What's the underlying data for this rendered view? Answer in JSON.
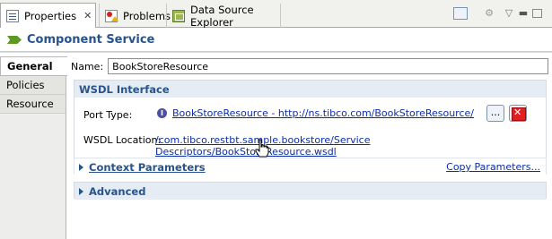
{
  "tabs": [
    {
      "label": "Properties",
      "icon": "properties-icon"
    },
    {
      "label": "Problems",
      "icon": "problems-icon"
    },
    {
      "label": "Data Source Explorer",
      "icon": "data-source-explorer-icon"
    }
  ],
  "header": {
    "title": "Component Service"
  },
  "nav": {
    "items": [
      "General",
      "Policies",
      "Resource"
    ]
  },
  "name_field": {
    "label": "Name:",
    "value": "BookStoreResource"
  },
  "wsdl": {
    "title": "WSDL Interface",
    "port_type_label": "Port Type:",
    "port_type_value": "BookStoreResource - http://ns.tibco.com/BookStoreResource/",
    "browse_label": "...",
    "location_label": "WSDL Location:",
    "location_value": "/com.tibco.restbt.sample.bookstore/Service Descriptors/BookStoreResource.wsdl"
  },
  "context": {
    "title": "Context Parameters",
    "copy_label": "Copy Parameters..."
  },
  "advanced": {
    "title": "Advanced"
  },
  "colors": {
    "accent": "#27548c",
    "link": "#0b2da6",
    "section_bg": "#e6ecf3"
  }
}
